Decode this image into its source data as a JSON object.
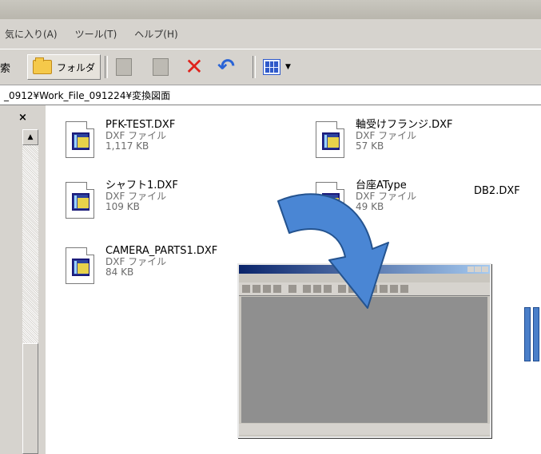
{
  "menubar": {
    "items": [
      "気に入り(A)",
      "ツール(T)",
      "ヘルプ(H)"
    ]
  },
  "toolbar": {
    "search_cut": "索",
    "folders_label": "フォルダ",
    "icons": [
      "up-folder-icon",
      "copy-to-icon",
      "delete-icon",
      "undo-icon",
      "views-icon"
    ]
  },
  "address": {
    "path": "_0912¥Work_File_091224¥変換図面"
  },
  "left_pane": {
    "close_glyph": "×",
    "scroll_up_glyph": "▲"
  },
  "files": [
    {
      "name": "PFK-TEST.DXF",
      "type": "DXF ファイル",
      "size": "1,117 KB"
    },
    {
      "name": "軸受けフランジ.DXF",
      "type": "DXF ファイル",
      "size": "57 KB"
    },
    {
      "name": "シャフト1.DXF",
      "type": "DXF ファイル",
      "size": "109 KB"
    },
    {
      "name": "台座AType",
      "type": "DXF ファイル",
      "size": "49 KB"
    },
    {
      "name": "CAMERA_PARTS1.DXF",
      "type": "DXF ファイル",
      "size": "84 KB"
    }
  ],
  "extra_label": "DB2.DXF",
  "colors": {
    "arrow_fill": "#4a86d4",
    "arrow_stroke": "#24538f",
    "delete_red": "#e0231c"
  }
}
